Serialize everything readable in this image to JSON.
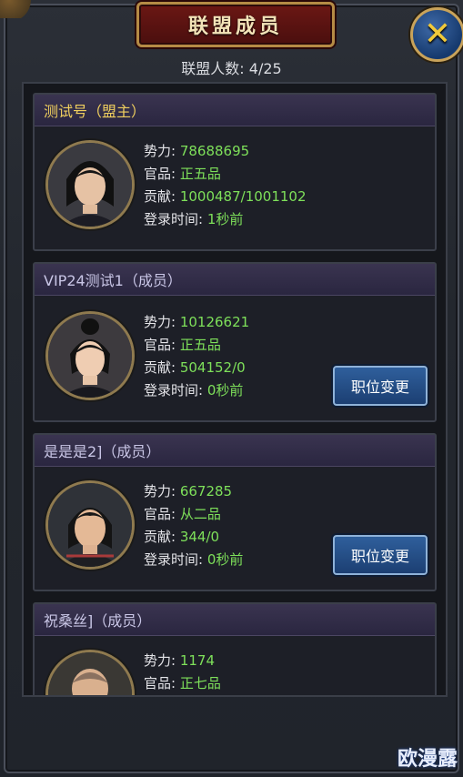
{
  "title": "联盟成员",
  "close_icon": "close-x-icon",
  "member_count_label": "联盟人数:",
  "member_count": "4/25",
  "labels": {
    "power": "势力:",
    "rank": "官品:",
    "contribution": "贡献:",
    "login": "登录时间:"
  },
  "members": [
    {
      "name_role": "测试号（盟主）",
      "power": "78688695",
      "rank": "正五品",
      "contribution": "1000487/1001102",
      "login": "1秒前",
      "action": ""
    },
    {
      "name_role": "VIP24测试1（成员）",
      "power": "10126621",
      "rank": "正五品",
      "contribution": "504152/0",
      "login": "0秒前",
      "action": "职位变更"
    },
    {
      "name_role": "是是是2]（成员）",
      "power": "667285",
      "rank": "从二品",
      "contribution": "344/0",
      "login": "0秒前",
      "action": "职位变更"
    },
    {
      "name_role": "祝桑丝]（成员）",
      "power": "1174",
      "rank": "正七品",
      "contribution": "",
      "login": "",
      "action": ""
    }
  ],
  "watermark": "欧漫露",
  "colors": {
    "value_green": "#7ee05a",
    "leader_gold": "#f0cf5e",
    "title_red": "#6b1714"
  }
}
